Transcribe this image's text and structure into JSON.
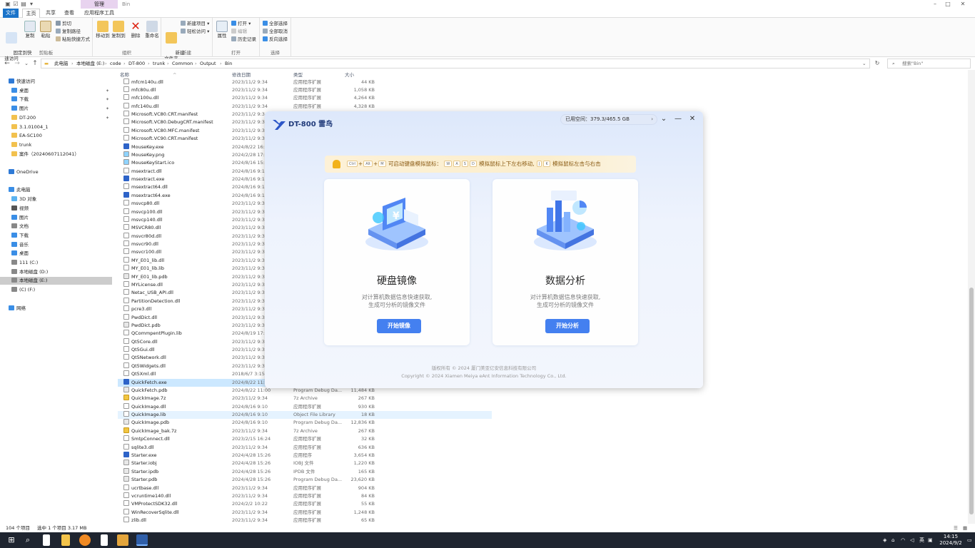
{
  "titlebar": {
    "manage_tab": "管理",
    "title": "Bin",
    "window_controls": [
      "–",
      "□",
      "✕"
    ]
  },
  "tabs": {
    "file": "文件",
    "home": "主页",
    "share": "共享",
    "view": "查看",
    "app_tools": "应用程序工具"
  },
  "ribbon": {
    "clipboard": {
      "pin": "固定到快\n速访问",
      "copy": "复制",
      "paste": "粘贴",
      "cut": "剪切",
      "copy_path": "复制路径",
      "paste_shortcut": "粘贴快捷方式",
      "label": "剪贴板"
    },
    "organize": {
      "move_to": "移动到",
      "copy_to": "复制到",
      "delete": "删除",
      "rename": "重命名",
      "label": "组织"
    },
    "new": {
      "new_folder": "新建\n文件夹",
      "new_item": "新建项目",
      "easy_access": "轻松访问",
      "label": "新建"
    },
    "open": {
      "properties": "属性",
      "open": "打开",
      "edit": "编辑",
      "history": "历史记录",
      "label": "打开"
    },
    "select": {
      "select_all": "全部选择",
      "select_none": "全部取消",
      "invert": "反向选择",
      "label": "选择"
    }
  },
  "address": {
    "crumbs": [
      "此电脑",
      "本地磁盘 (E:)",
      "code",
      "DT-800",
      "trunk",
      "Common",
      "Output",
      "Bin"
    ],
    "search_placeholder": "搜索\"Bin\""
  },
  "nav": [
    {
      "label": "快速访问",
      "icon": "star-icon",
      "color": "#2f7ad6",
      "indent": 1,
      "pin": false
    },
    {
      "label": "桌面",
      "icon": "desktop-icon",
      "color": "#3a8ee6",
      "indent": 2,
      "pin": true
    },
    {
      "label": "下载",
      "icon": "download-icon",
      "color": "#3a8ee6",
      "indent": 2,
      "pin": true
    },
    {
      "label": "图片",
      "icon": "pictures-icon",
      "color": "#3a8ee6",
      "indent": 2,
      "pin": true
    },
    {
      "label": "DT-200",
      "icon": "folder-icon",
      "color": "#f2c14e",
      "indent": 2,
      "pin": true
    },
    {
      "label": "3.1.01004_1",
      "icon": "folder-icon",
      "color": "#f2c14e",
      "indent": 2,
      "pin": false
    },
    {
      "label": "EA-SC100",
      "icon": "folder-icon",
      "color": "#f2c14e",
      "indent": 2,
      "pin": false
    },
    {
      "label": "trunk",
      "icon": "folder-icon",
      "color": "#f2c14e",
      "indent": 2,
      "pin": false
    },
    {
      "label": "案件（20240607112041）",
      "icon": "folder-icon",
      "color": "#f2c14e",
      "indent": 2,
      "pin": false
    },
    {
      "label": "",
      "icon": "",
      "color": "",
      "indent": 0,
      "pin": false
    },
    {
      "label": "OneDrive",
      "icon": "cloud-icon",
      "color": "#2f7ad6",
      "indent": 1,
      "pin": false
    },
    {
      "label": "",
      "icon": "",
      "color": "",
      "indent": 0,
      "pin": false
    },
    {
      "label": "此电脑",
      "icon": "computer-icon",
      "color": "#3a8ee6",
      "indent": 1,
      "pin": false
    },
    {
      "label": "3D 对象",
      "icon": "cube-icon",
      "color": "#5cb3f0",
      "indent": 2,
      "pin": false
    },
    {
      "label": "视频",
      "icon": "video-icon",
      "color": "#555",
      "indent": 2,
      "pin": false
    },
    {
      "label": "图片",
      "icon": "pictures-icon",
      "color": "#3a8ee6",
      "indent": 2,
      "pin": false
    },
    {
      "label": "文档",
      "icon": "document-icon",
      "color": "#888",
      "indent": 2,
      "pin": false
    },
    {
      "label": "下载",
      "icon": "download-icon",
      "color": "#3a8ee6",
      "indent": 2,
      "pin": false
    },
    {
      "label": "音乐",
      "icon": "music-icon",
      "color": "#3a8ee6",
      "indent": 2,
      "pin": false
    },
    {
      "label": "桌面",
      "icon": "desktop-icon",
      "color": "#3a8ee6",
      "indent": 2,
      "pin": false
    },
    {
      "label": "111 (C:)",
      "icon": "drive-icon",
      "color": "#888",
      "indent": 2,
      "pin": false
    },
    {
      "label": "本地磁盘 (D:)",
      "icon": "drive-icon",
      "color": "#888",
      "indent": 2,
      "pin": false
    },
    {
      "label": "本地磁盘 (E:)",
      "icon": "drive-icon",
      "color": "#888",
      "indent": 2,
      "pin": false,
      "selected": true
    },
    {
      "label": "(C) (F:)",
      "icon": "drive-icon",
      "color": "#888",
      "indent": 2,
      "pin": false
    },
    {
      "label": "",
      "icon": "",
      "color": "",
      "indent": 0,
      "pin": false
    },
    {
      "label": "网络",
      "icon": "network-icon",
      "color": "#3a8ee6",
      "indent": 1,
      "pin": false
    }
  ],
  "columns": {
    "name": "名称",
    "modified": "修改日期",
    "type": "类型",
    "size": "大小"
  },
  "files": [
    {
      "name": "mfcm140u.dll",
      "date": "2023/11/2 9:34",
      "type": "应用程序扩展",
      "size": "44 KB",
      "icon": "dll"
    },
    {
      "name": "mfc80u.dll",
      "date": "2023/11/2 9:34",
      "type": "应用程序扩展",
      "size": "1,058 KB",
      "icon": "dll"
    },
    {
      "name": "mfc100u.dll",
      "date": "2023/11/2 9:34",
      "type": "应用程序扩展",
      "size": "4,264 KB",
      "icon": "dll"
    },
    {
      "name": "mfc140u.dll",
      "date": "2023/11/2 9:34",
      "type": "应用程序扩展",
      "size": "4,328 KB",
      "icon": "dll"
    },
    {
      "name": "Microsoft.VC80.CRT.manifest",
      "date": "2023/11/2 9:34",
      "type": "",
      "size": "",
      "icon": "dll"
    },
    {
      "name": "Microsoft.VC80.DebugCRT.manifest",
      "date": "2023/11/2 9:34",
      "type": "",
      "size": "",
      "icon": "dll"
    },
    {
      "name": "Microsoft.VC80.MFC.manifest",
      "date": "2023/11/2 9:34",
      "type": "",
      "size": "",
      "icon": "dll"
    },
    {
      "name": "Microsoft.VC90.CRT.manifest",
      "date": "2023/11/2 9:34",
      "type": "",
      "size": "",
      "icon": "dll"
    },
    {
      "name": "MouseKey.exe",
      "date": "2024/8/22 16:",
      "type": "",
      "size": "",
      "icon": "exe"
    },
    {
      "name": "MouseKey.png",
      "date": "2024/2/28 17:",
      "type": "",
      "size": "",
      "icon": "png"
    },
    {
      "name": "MouseKeyStart.ico",
      "date": "2024/8/16 15:",
      "type": "",
      "size": "",
      "icon": "png"
    },
    {
      "name": "msextract.dll",
      "date": "2024/8/16 9:1",
      "type": "",
      "size": "",
      "icon": "dll"
    },
    {
      "name": "msextract.exe",
      "date": "2024/8/16 9:1",
      "type": "",
      "size": "",
      "icon": "exe"
    },
    {
      "name": "msextract64.dll",
      "date": "2024/8/16 9:1",
      "type": "",
      "size": "",
      "icon": "dll"
    },
    {
      "name": "msextract64.exe",
      "date": "2024/8/16 9:1",
      "type": "",
      "size": "",
      "icon": "exe"
    },
    {
      "name": "msvcp80.dll",
      "date": "2023/11/2 9:3",
      "type": "",
      "size": "",
      "icon": "dll"
    },
    {
      "name": "msvcp100.dll",
      "date": "2023/11/2 9:3",
      "type": "",
      "size": "",
      "icon": "dll"
    },
    {
      "name": "msvcp140.dll",
      "date": "2023/11/2 9:3",
      "type": "",
      "size": "",
      "icon": "dll"
    },
    {
      "name": "MSVCR80.dll",
      "date": "2023/11/2 9:3",
      "type": "",
      "size": "",
      "icon": "dll"
    },
    {
      "name": "msvcr80d.dll",
      "date": "2023/11/2 9:3",
      "type": "",
      "size": "",
      "icon": "dll"
    },
    {
      "name": "msvcr90.dll",
      "date": "2023/11/2 9:3",
      "type": "",
      "size": "",
      "icon": "dll"
    },
    {
      "name": "msvcr100.dll",
      "date": "2023/11/2 9:3",
      "type": "",
      "size": "",
      "icon": "dll"
    },
    {
      "name": "MY_E01_lib.dll",
      "date": "2023/11/2 9:3",
      "type": "",
      "size": "",
      "icon": "dll"
    },
    {
      "name": "MY_E01_lib.lib",
      "date": "2023/11/2 9:3",
      "type": "",
      "size": "",
      "icon": "dll"
    },
    {
      "name": "MY_E01_lib.pdb",
      "date": "2023/11/2 9:3",
      "type": "",
      "size": "",
      "icon": "pdb"
    },
    {
      "name": "MYLicense.dll",
      "date": "2023/11/2 9:3",
      "type": "",
      "size": "",
      "icon": "dll"
    },
    {
      "name": "Netac_USB_API.dll",
      "date": "2023/11/2 9:3",
      "type": "",
      "size": "",
      "icon": "dll"
    },
    {
      "name": "PartitionDetection.dll",
      "date": "2023/11/2 9:3",
      "type": "",
      "size": "",
      "icon": "dll"
    },
    {
      "name": "pcre3.dll",
      "date": "2023/11/2 9:3",
      "type": "",
      "size": "",
      "icon": "dll"
    },
    {
      "name": "PwdDict.dll",
      "date": "2023/11/2 9:3",
      "type": "",
      "size": "",
      "icon": "dll"
    },
    {
      "name": "PwdDict.pdb",
      "date": "2023/11/2 9:3",
      "type": "",
      "size": "",
      "icon": "pdb"
    },
    {
      "name": "QCommpentPlugin.lib",
      "date": "2024/8/19 17:",
      "type": "",
      "size": "",
      "icon": "dll"
    },
    {
      "name": "Qt5Core.dll",
      "date": "2023/11/2 9:3",
      "type": "",
      "size": "",
      "icon": "dll"
    },
    {
      "name": "Qt5Gui.dll",
      "date": "2023/11/2 9:3",
      "type": "",
      "size": "",
      "icon": "dll"
    },
    {
      "name": "Qt5Network.dll",
      "date": "2023/11/2 9:3",
      "type": "",
      "size": "",
      "icon": "dll"
    },
    {
      "name": "Qt5Widgets.dll",
      "date": "2023/11/2 9:3",
      "type": "",
      "size": "",
      "icon": "dll"
    },
    {
      "name": "Qt5Xml.dll",
      "date": "2018/6/7 3:15",
      "type": "",
      "size": "",
      "icon": "dll"
    },
    {
      "name": "QuickFetch.exe",
      "date": "2024/8/22 11:",
      "type": "",
      "size": "",
      "icon": "exe",
      "selected": true
    },
    {
      "name": "QuickFetch.pdb",
      "date": "2024/8/22 11:00",
      "type": "Program Debug Da...",
      "size": "11,484 KB",
      "icon": "pdb"
    },
    {
      "name": "QuickImage.7z",
      "date": "2023/11/2 9:34",
      "type": "7z Archive",
      "size": "267 KB",
      "icon": "zip"
    },
    {
      "name": "QuickImage.dll",
      "date": "2024/8/16 9:10",
      "type": "应用程序扩展",
      "size": "930 KB",
      "icon": "dll"
    },
    {
      "name": "QuickImage.lib",
      "date": "2024/8/16 9:10",
      "type": "Object File Library",
      "size": "18 KB",
      "icon": "dll",
      "hover": true
    },
    {
      "name": "QuickImage.pdb",
      "date": "2024/8/16 9:10",
      "type": "Program Debug Da...",
      "size": "12,836 KB",
      "icon": "pdb"
    },
    {
      "name": "QuickImage_bak.7z",
      "date": "2023/11/2 9:34",
      "type": "7z Archive",
      "size": "267 KB",
      "icon": "zip"
    },
    {
      "name": "SmtpConnect.dll",
      "date": "2023/2/15 16:24",
      "type": "应用程序扩展",
      "size": "32 KB",
      "icon": "dll"
    },
    {
      "name": "sqlite3.dll",
      "date": "2023/11/2 9:34",
      "type": "应用程序扩展",
      "size": "636 KB",
      "icon": "dll"
    },
    {
      "name": "Starter.exe",
      "date": "2024/4/28 15:26",
      "type": "应用程序",
      "size": "3,654 KB",
      "icon": "exe"
    },
    {
      "name": "Starter.iobj",
      "date": "2024/4/28 15:26",
      "type": "IOBJ 文件",
      "size": "1,220 KB",
      "icon": "pdb"
    },
    {
      "name": "Starter.ipdb",
      "date": "2024/4/28 15:26",
      "type": "IPDB 文件",
      "size": "165 KB",
      "icon": "pdb"
    },
    {
      "name": "Starter.pdb",
      "date": "2024/4/28 15:26",
      "type": "Program Debug Da...",
      "size": "23,620 KB",
      "icon": "pdb"
    },
    {
      "name": "ucrtbase.dll",
      "date": "2023/11/2 9:34",
      "type": "应用程序扩展",
      "size": "904 KB",
      "icon": "dll"
    },
    {
      "name": "vcruntime140.dll",
      "date": "2023/11/2 9:34",
      "type": "应用程序扩展",
      "size": "84 KB",
      "icon": "dll"
    },
    {
      "name": "VMProtectSDK32.dll",
      "date": "2024/2/2 10:22",
      "type": "应用程序扩展",
      "size": "55 KB",
      "icon": "dll"
    },
    {
      "name": "WinRecoverSqlite.dll",
      "date": "2023/11/2 9:34",
      "type": "应用程序扩展",
      "size": "1,248 KB",
      "icon": "dll"
    },
    {
      "name": "zlib.dll",
      "date": "2023/11/2 9:34",
      "type": "应用程序扩展",
      "size": "65 KB",
      "icon": "dll"
    }
  ],
  "status": {
    "count": "104 个项目",
    "selection": "选中 1 个项目  3.17 MB"
  },
  "taskbar": {
    "time": "14:15",
    "date": "2024/9/2",
    "ime": "英"
  },
  "app": {
    "title": "DT-800 雷鸟",
    "space_label": "已用空间：379.3/465.5 GB",
    "tip_prefix": "可启动键盘模拟鼠标：",
    "tip_move": "模拟鼠标上下左右移动,",
    "tip_click": "模拟鼠标左击与右击",
    "keys": {
      "ctrl": "Ctrl",
      "alt": "Alt",
      "m": "M",
      "w": "W",
      "a": "A",
      "s": "S",
      "d": "D",
      "j": "J",
      "k": "K"
    },
    "card1": {
      "title": "硬盘镜像",
      "desc1": "对计算机数据信息快速获取,",
      "desc2": "生成可分析的镜像文件",
      "button": "开始镜像"
    },
    "card2": {
      "title": "数据分析",
      "desc1": "对计算机数据信息快速获取,",
      "desc2": "生成可分析的镜像文件",
      "button": "开始分析"
    },
    "copyright_cn": "版权所有 © 2024 厦门美亚亿安信息科技有限公司",
    "copyright_en": "Copyright © 2024 Xiamen Meiya eAnt Information Technology Co., Ltd.",
    "accent": "#3e7cf0"
  }
}
